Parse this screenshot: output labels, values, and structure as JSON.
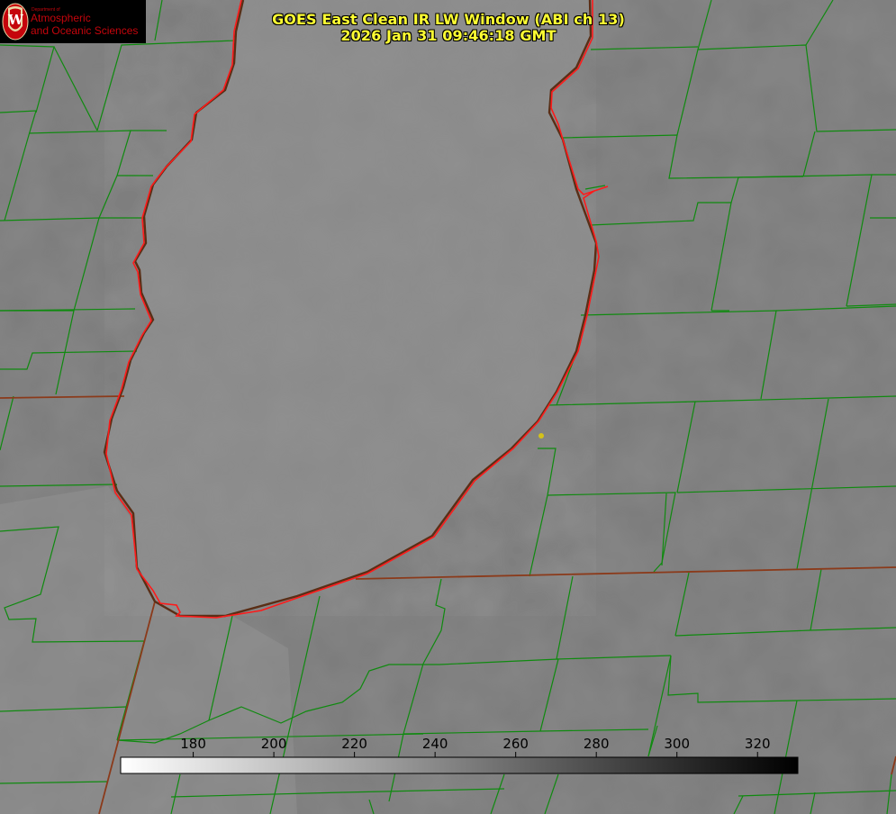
{
  "title": {
    "line1": "GOES East Clean IR LW Window (ABI ch 13)",
    "line2": "2026 Jan 31 09:46:18 GMT"
  },
  "logo": {
    "department": "Department of",
    "line1": "Atmospheric",
    "line2": "and Oceanic Sciences",
    "shield_letter": "W"
  },
  "colorbar": {
    "min": 162,
    "max": 330,
    "ticks": [
      180,
      200,
      220,
      240,
      260,
      280,
      300,
      320
    ],
    "gradient": [
      "#ffffff",
      "#000000"
    ]
  },
  "colors": {
    "background_gray": "#7d7d7d",
    "lake_gray": "#8c8c8c",
    "county_lines": "#0f8a0f",
    "state_lines": "#8b3a1a",
    "shoreline_red": "#ff1a1a",
    "title_yellow": "#ffff33",
    "marker_yellow": "#d4c21a"
  }
}
